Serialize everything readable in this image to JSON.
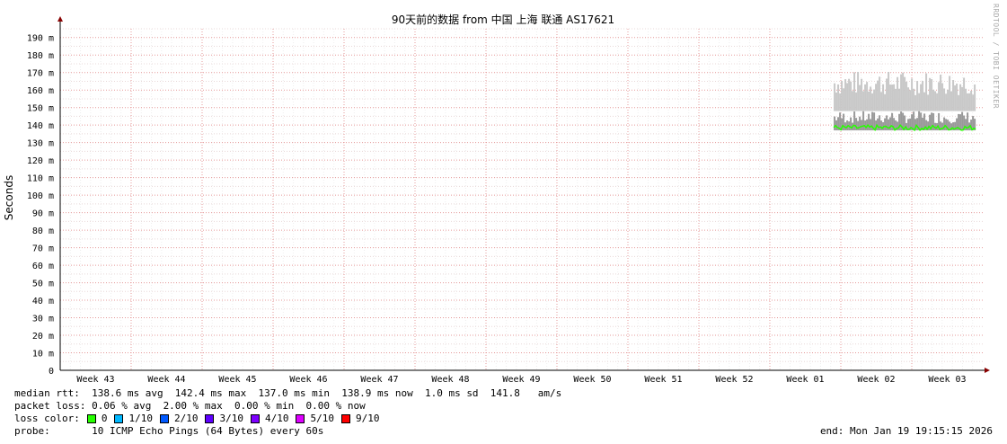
{
  "chart_data": {
    "type": "line",
    "title": "90天前的数据 from 中国 上海 联通 AS17621",
    "ylabel": "Seconds",
    "ylim": [
      0,
      195
    ],
    "y_ticks": [
      "0",
      "10 m",
      "20 m",
      "30 m",
      "40 m",
      "50 m",
      "60 m",
      "70 m",
      "80 m",
      "90 m",
      "100 m",
      "110 m",
      "120 m",
      "130 m",
      "140 m",
      "150 m",
      "160 m",
      "170 m",
      "180 m",
      "190 m"
    ],
    "x_ticks": [
      "Week 43",
      "Week 44",
      "Week 45",
      "Week 46",
      "Week 47",
      "Week 48",
      "Week 49",
      "Week 50",
      "Week 51",
      "Week 52",
      "Week 01",
      "Week 02",
      "Week 03"
    ],
    "x_range_weeks": [
      0,
      13
    ],
    "data_start_week": 10.9,
    "data_end_week": 12.9,
    "series": [
      {
        "name": "0",
        "role": "median",
        "color": "#26ff00",
        "range_ms": [
          137,
          140
        ],
        "value_ms": 138.6
      },
      {
        "role": "smoke-max",
        "color": "#c8c8c8",
        "range_ms": [
          157,
          171
        ]
      },
      {
        "role": "smoke-inner",
        "color": "#999999",
        "range_ms": [
          141,
          148
        ]
      }
    ],
    "grid": true
  },
  "stats": {
    "median": "median rtt:  138.6 ms avg  142.4 ms max  137.0 ms min  138.9 ms now  1.0 ms sd  141.8   am/s",
    "loss": "packet loss: 0.06 % avg  2.00 % max  0.00 % min  0.00 % now",
    "loss_label": "loss color:",
    "probe": "probe:       10 ICMP Echo Pings (64 Bytes) every 60s",
    "end": "end: Mon Jan 19 19:15:15 2026"
  },
  "loss_colors": [
    {
      "label": "0",
      "color": "#26ff00"
    },
    {
      "label": "1/10",
      "color": "#00b8ff"
    },
    {
      "label": "2/10",
      "color": "#0059ff"
    },
    {
      "label": "3/10",
      "color": "#5e00ff"
    },
    {
      "label": "4/10",
      "color": "#7e00ff"
    },
    {
      "label": "5/10",
      "color": "#dd00ff"
    },
    {
      "label": "9/10",
      "color": "#ff0000"
    }
  ],
  "credit": "RRDTOOL / TOBI OETIKER"
}
